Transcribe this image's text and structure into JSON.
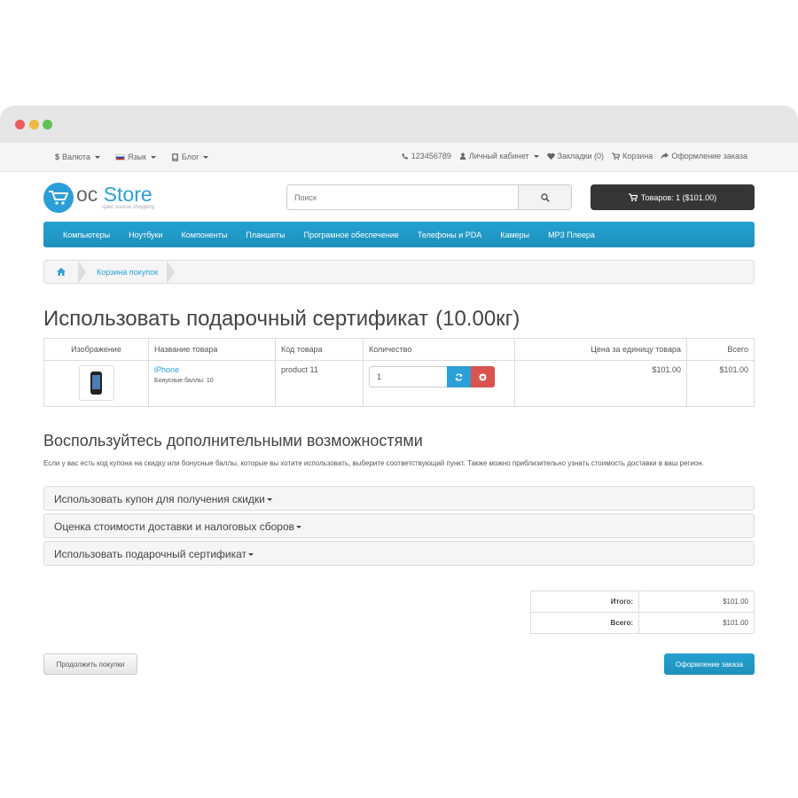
{
  "topbar": {
    "currency": "Валюта",
    "language": "Язык",
    "blog": "Блог",
    "phone": "123456789",
    "account": "Личный кабинет",
    "wishlist": "Закладки (0)",
    "cart": "Корзина",
    "checkout": "Оформление заказа"
  },
  "logo": {
    "oc": "oc",
    "store": "Store",
    "tagline": "open source shopping"
  },
  "search": {
    "placeholder": "Поиск"
  },
  "cart_button": "Товаров: 1 ($101.00)",
  "menu": [
    "Компьютеры",
    "Ноутбуки",
    "Компоненты",
    "Планшеты",
    "Програмное обеспечение",
    "Телефоны и PDA",
    "Камеры",
    "MP3 Плеера"
  ],
  "breadcrumb": {
    "item": "Корзина покупок"
  },
  "page": {
    "title": "Использовать подарочный сертификат",
    "weight": "(10.00кг)"
  },
  "table": {
    "headers": [
      "Изображение",
      "Название товара",
      "Код товара",
      "Количество",
      "Цена за единицу товара",
      "Всего"
    ],
    "row": {
      "name": "iPhone",
      "bonus": "Бонусные баллы: 10",
      "model": "product 11",
      "quantity": "1",
      "unit_price": "$101.00",
      "total": "$101.00"
    }
  },
  "options": {
    "title": "Воспользуйтесь дополнительными возможностями",
    "description": "Если у вас есть код купона на скидку или бонусные баллы, которые вы хотите использовать, выберите соответствующий пункт. Также можно приблизительно узнать стоимость доставки в ваш регион.",
    "panels": [
      "Использовать купон для получения скидки",
      "Оценка стоимости доставки и налоговых сборов",
      "Использовать подарочный сертификат"
    ]
  },
  "totals": {
    "subtotal_label": "Итого:",
    "subtotal_value": "$101.00",
    "total_label": "Всего:",
    "total_value": "$101.00"
  },
  "buttons": {
    "continue": "Продолжить покупки",
    "checkout": "Оформление заказа"
  },
  "colors": {
    "accent": "#229ac8",
    "dark": "#363636",
    "danger": "#d9534f"
  }
}
